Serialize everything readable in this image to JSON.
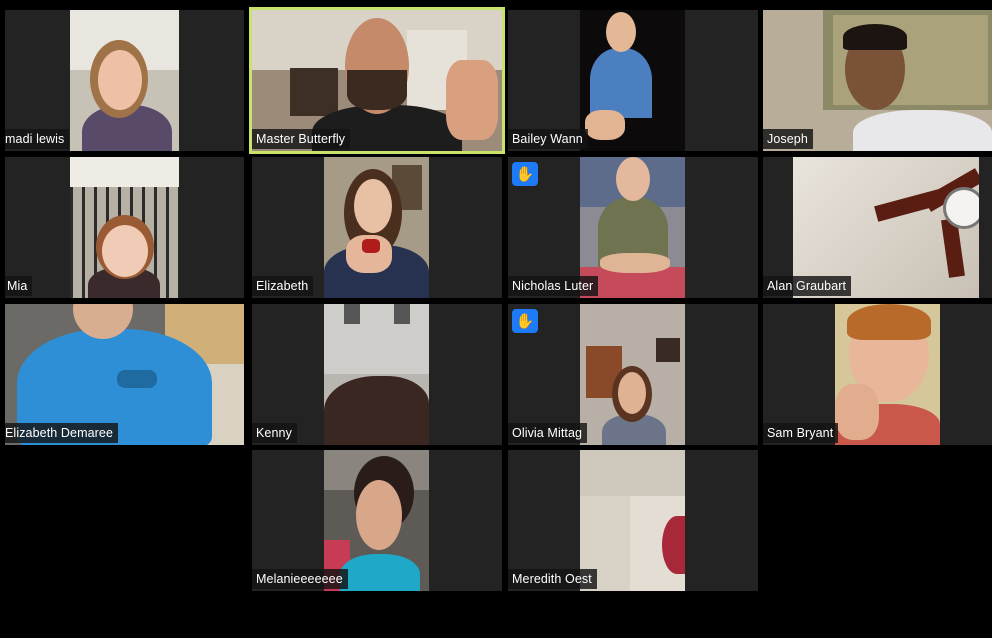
{
  "meeting": {
    "view": "gallery",
    "active_speaker": "Master Butterfly",
    "colors": {
      "background": "#000000",
      "tile": "#232323",
      "active_border": "#c9e26b",
      "raise_hand": "#1d7bf7"
    }
  },
  "participants": [
    {
      "name": "madi lewis",
      "hand_raised": false,
      "video_on": true
    },
    {
      "name": "Master Butterfly",
      "hand_raised": false,
      "video_on": true
    },
    {
      "name": "Bailey Wann",
      "hand_raised": false,
      "video_on": true
    },
    {
      "name": "Joseph",
      "hand_raised": false,
      "video_on": true
    },
    {
      "name": "Mia",
      "hand_raised": false,
      "video_on": true
    },
    {
      "name": "Elizabeth",
      "hand_raised": false,
      "video_on": true
    },
    {
      "name": "Nicholas Luter",
      "hand_raised": true,
      "video_on": true
    },
    {
      "name": "Alan Graubart",
      "hand_raised": false,
      "video_on": true
    },
    {
      "name": "Elizabeth Demaree",
      "hand_raised": false,
      "video_on": true
    },
    {
      "name": "Kenny",
      "hand_raised": false,
      "video_on": true
    },
    {
      "name": "Olivia Mittag",
      "hand_raised": true,
      "video_on": true
    },
    {
      "name": "Sam Bryant",
      "hand_raised": false,
      "video_on": true
    },
    {
      "name": "Melanieeeeeee",
      "hand_raised": false,
      "video_on": true
    },
    {
      "name": "Meredith Oest",
      "hand_raised": false,
      "video_on": true
    }
  ],
  "icons": {
    "raise_hand": "raise-hand-icon"
  }
}
